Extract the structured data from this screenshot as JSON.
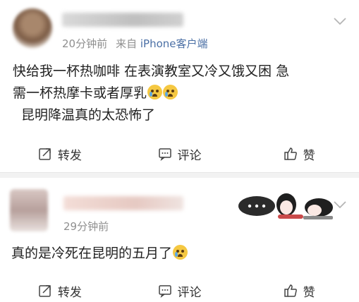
{
  "posts": [
    {
      "time": "20分钟前",
      "source_prefix": "来自",
      "device": "iPhone客户端",
      "content_lines": [
        "快给我一杯热咖啡 在表演教室又冷又饿又困 急",
        "需一杯热摩卡或者厚乳",
        "昆明降温真的太恐怖了"
      ],
      "emojis_after_line_2": [
        "crying-face-emoji",
        "crying-face-emoji"
      ],
      "actions": {
        "repost": "转发",
        "comment": "评论",
        "like": "赞"
      }
    },
    {
      "time": "29分钟前",
      "content_lines": [
        "真的是冷死在昆明的五月了"
      ],
      "emojis_after_line_1": [
        "crying-face-emoji"
      ],
      "actions": {
        "repost": "转发",
        "comment": "评论",
        "like": "赞"
      }
    }
  ],
  "colors": {
    "link": "#4a6fa5",
    "meta": "#8f8f8f",
    "divider": "#f2f2f2"
  }
}
